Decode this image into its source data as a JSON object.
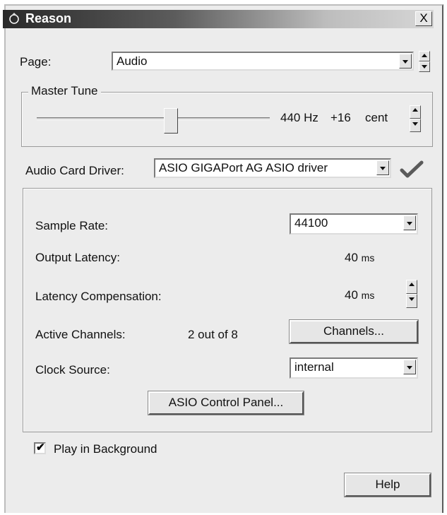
{
  "window": {
    "title": "Reason",
    "close_glyph": "X"
  },
  "page_selector": {
    "label": "Page:",
    "value": "Audio"
  },
  "master_tune": {
    "group_label": "Master Tune",
    "frequency": "440 Hz",
    "offset": "+16",
    "unit": "cent"
  },
  "audio_card_driver": {
    "label": "Audio Card Driver:",
    "value": "ASIO GIGAPort AG ASIO driver"
  },
  "sample_rate": {
    "label": "Sample Rate:",
    "value": "44100"
  },
  "output_latency": {
    "label": "Output Latency:",
    "value": "40",
    "unit": "ms"
  },
  "latency_compensation": {
    "label": "Latency Compensation:",
    "value": "40",
    "unit": "ms"
  },
  "active_channels": {
    "label": "Active Channels:",
    "value": "2 out of 8",
    "button": "Channels..."
  },
  "clock_source": {
    "label": "Clock Source:",
    "value": "internal"
  },
  "asio_button": "ASIO Control Panel...",
  "play_in_background": {
    "label": "Play in Background",
    "checked": true
  },
  "help_button": "Help",
  "icons": [
    "app-icon",
    "close-icon",
    "chevron-down-icon",
    "spinner-icon",
    "checkmark-icon"
  ]
}
